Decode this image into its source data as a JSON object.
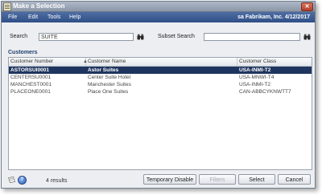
{
  "window": {
    "title": "Make a Selection",
    "close_glyph": "✕"
  },
  "menubar": {
    "items": [
      "File",
      "Edit",
      "Tools",
      "Help"
    ],
    "context": "sa  Fabrikam, Inc.  4/12/2017"
  },
  "search": {
    "label": "Search",
    "value": "SUITE",
    "subset_label": "Subset Search",
    "subset_value": ""
  },
  "grid": {
    "section_title": "Customers",
    "sort_indicator": "▲",
    "columns": [
      "Customer Number",
      "Customer Name",
      "Customer Class"
    ],
    "rows": [
      [
        "ASTORSUI0001",
        "Astor Suites",
        "USA-INMI-T2"
      ],
      [
        "CENTERSU0001",
        "Center Suite Hotel",
        "USA-MNWI-T4"
      ],
      [
        "MANCHEST0001",
        "Manchester Suites",
        "USA-INMI-T2"
      ],
      [
        "PLACEONE0001",
        "Place One Suites",
        "CAN-ABBCYKNWTT7"
      ]
    ],
    "selected_row": 0
  },
  "footer": {
    "results_text": "4 results",
    "help_glyph": "?",
    "buttons": {
      "temporary_disable": "Temporary Disable",
      "filters": "Filters",
      "select": "Select",
      "cancel": "Cancel"
    }
  },
  "icons": {
    "note": "note-icon",
    "help": "help-icon",
    "search": "binoculars-icon"
  },
  "colors": {
    "menubar": "#2f4f86",
    "selection": "#1f355f",
    "window_bg": "#eceef1"
  }
}
